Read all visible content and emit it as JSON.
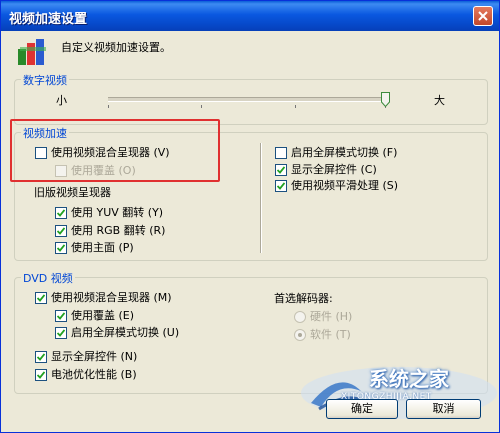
{
  "window": {
    "title": "视频加速设置",
    "description": "自定义视频加速设置。"
  },
  "digital_video": {
    "legend": "数字视频",
    "slider_min_label": "小",
    "slider_max_label": "大",
    "slider_level": 1.0
  },
  "video_acceleration": {
    "legend": "视频加速",
    "use_mixing_renderer": {
      "label": "使用视频混合呈现器 (V)",
      "checked": false
    },
    "use_overlay": {
      "label": "使用覆盖 (O)",
      "checked": false,
      "disabled": true
    },
    "legacy_renderer_label": "旧版视频呈现器",
    "legacy": [
      {
        "label": "使用 YUV 翻转 (Y)",
        "checked": true
      },
      {
        "label": "使用 RGB 翻转 (R)",
        "checked": true
      },
      {
        "label": "使用主面 (P)",
        "checked": true
      }
    ],
    "right": [
      {
        "label": "启用全屏模式切换 (F)",
        "checked": false
      },
      {
        "label": "显示全屏控件 (C)",
        "checked": true
      },
      {
        "label": "使用视频平滑处理 (S)",
        "checked": true
      }
    ]
  },
  "dvd_video": {
    "legend": "DVD 视频",
    "use_mixing_renderer": {
      "label": "使用视频混合呈现器 (M)",
      "checked": true
    },
    "use_overlay": {
      "label": "使用覆盖 (E)",
      "checked": true
    },
    "enable_fullscreen": {
      "label": "启用全屏模式切换 (U)",
      "checked": true
    },
    "show_fullscreen_controls": {
      "label": "显示全屏控件 (N)",
      "checked": true
    },
    "battery_opt": {
      "label": "电池优化性能 (B)",
      "checked": true
    },
    "decoder_label": "首选解码器:",
    "decoder_options": [
      {
        "label": "硬件 (H)",
        "selected": false
      },
      {
        "label": "软件 (T)",
        "selected": true
      }
    ]
  },
  "buttons": {
    "ok": "确定",
    "cancel": "取消"
  },
  "watermark": {
    "name": "系统之家",
    "url": "XITONGZHIJIA.NET"
  },
  "colors": {
    "title_bar": "#0a58e0",
    "legend_text": "#0046d5",
    "highlight_box": "#e03030",
    "dialog_bg": "#ece9d8"
  }
}
